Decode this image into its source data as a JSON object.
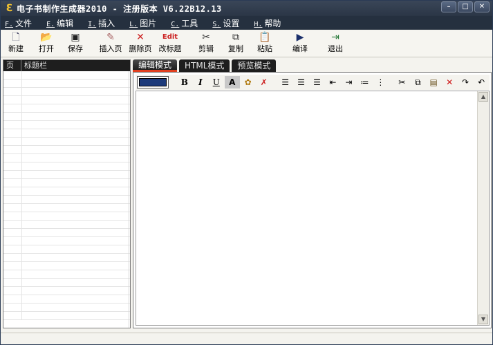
{
  "window": {
    "title": "电子书制作生成器2010 - 注册版本 V6.22B12.13",
    "buttons": {
      "minimize": "–",
      "maximize": "□",
      "close": "✕"
    }
  },
  "menu": [
    {
      "key": "F.",
      "label": "文件"
    },
    {
      "key": "E.",
      "label": "编辑"
    },
    {
      "key": "I.",
      "label": "插入"
    },
    {
      "key": "L.",
      "label": "图片"
    },
    {
      "key": "C.",
      "label": "工具"
    },
    {
      "key": "S.",
      "label": "设置"
    },
    {
      "key": "H.",
      "label": "帮助"
    }
  ],
  "toolbar": [
    {
      "label": "新建",
      "icon": "new-icon"
    },
    {
      "label": "打开",
      "icon": "open-icon"
    },
    {
      "label": "保存",
      "icon": "save-icon"
    },
    {
      "label": "插入页",
      "icon": "insert-page-icon"
    },
    {
      "label": "删除页",
      "icon": "delete-page-icon"
    },
    {
      "label": "改标题",
      "icon": "edit-title-icon"
    },
    {
      "label": "剪辑",
      "icon": "cut-icon"
    },
    {
      "label": "复制",
      "icon": "copy-icon"
    },
    {
      "label": "粘贴",
      "icon": "paste-icon"
    },
    {
      "label": "编译",
      "icon": "compile-icon"
    },
    {
      "label": "退出",
      "icon": "exit-icon"
    }
  ],
  "page_list": {
    "col_page": "页",
    "col_title": "标题栏"
  },
  "tabs": [
    {
      "label": "编辑模式",
      "active": true
    },
    {
      "label": "HTML模式",
      "active": false
    },
    {
      "label": "预览模式",
      "active": false
    }
  ],
  "editor_toolbar": {
    "bold": "B",
    "italic": "I",
    "underline": "U",
    "font_color": "A",
    "font_color_value": "#1e3b7a"
  },
  "colors": {
    "titlebar": "#2b3646",
    "menubar": "#25303f",
    "tab_active_accent": "#e04020"
  }
}
